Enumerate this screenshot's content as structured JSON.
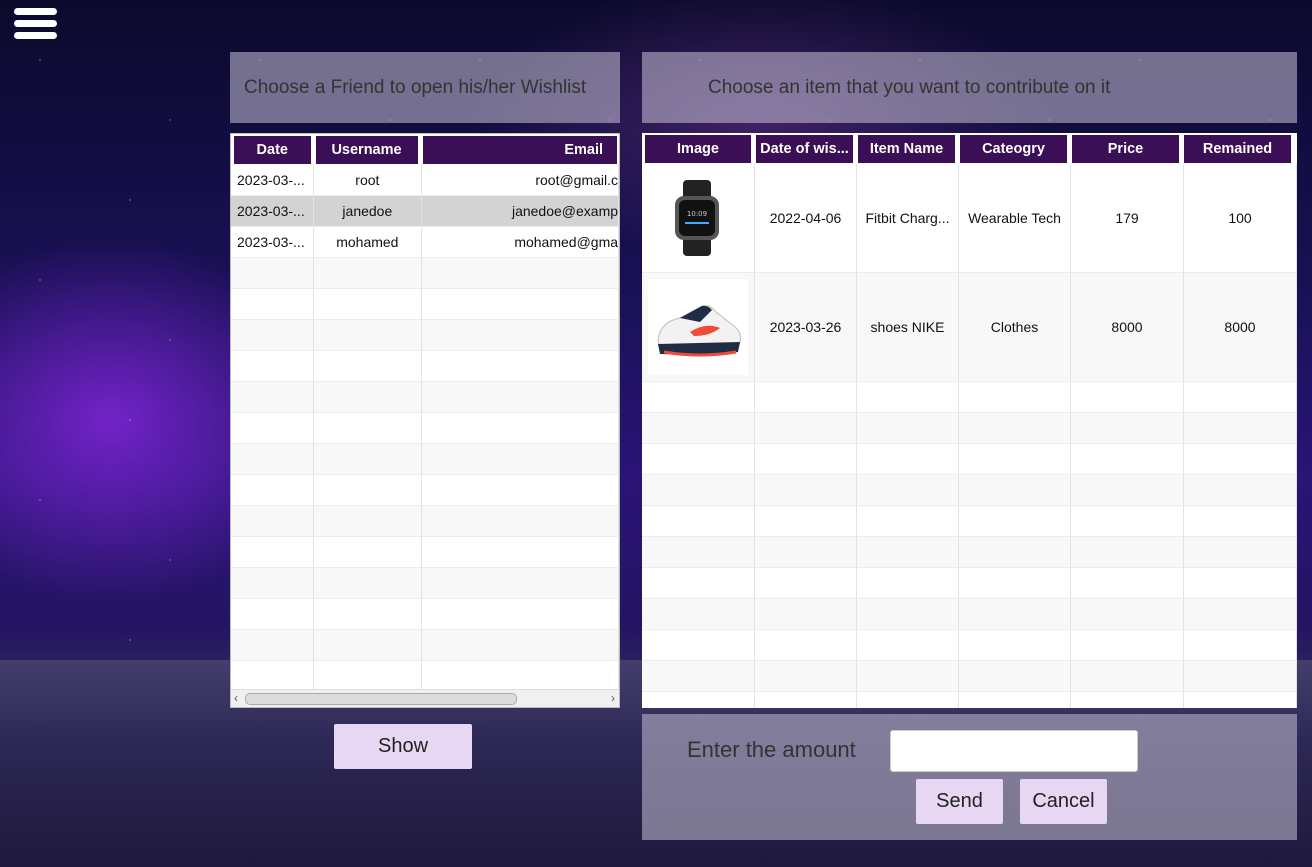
{
  "friends_panel": {
    "header": "Choose a Friend to open his/her Wishlist",
    "columns": [
      "Date",
      "Username",
      "Email"
    ],
    "rows": [
      {
        "date": "2023-03-...",
        "username": "root",
        "email": "root@gmail.c"
      },
      {
        "date": "2023-03-...",
        "username": "janedoe",
        "email": "janedoe@examp"
      },
      {
        "date": "2023-03-...",
        "username": "mohamed",
        "email": "mohamed@gma"
      }
    ],
    "selected_index": 1,
    "show_button": "Show"
  },
  "items_panel": {
    "header": "Choose an item that you want to contribute on it",
    "columns": [
      "Image",
      "Date of wis...",
      "Item Name",
      "Cateogry",
      "Price",
      "Remained"
    ],
    "rows": [
      {
        "image": "smartwatch-image",
        "date": "2022-04-06",
        "item_name": "Fitbit Charg...",
        "category": "Wearable Tech",
        "price": "179",
        "remained": "100"
      },
      {
        "image": "sneaker-image",
        "date": "2023-03-26",
        "item_name": "shoes NIKE",
        "category": "Clothes",
        "price": "8000",
        "remained": "8000"
      }
    ]
  },
  "contribution": {
    "amount_label": "Enter the amount",
    "amount_value": "",
    "send_button": "Send",
    "cancel_button": "Cancel"
  },
  "colors": {
    "header_bg": "#3a0f55",
    "button_bg": "#e8d7f3",
    "selected_row": "#d3d3d3"
  },
  "icons": {
    "menu": "hamburger-menu-icon"
  }
}
